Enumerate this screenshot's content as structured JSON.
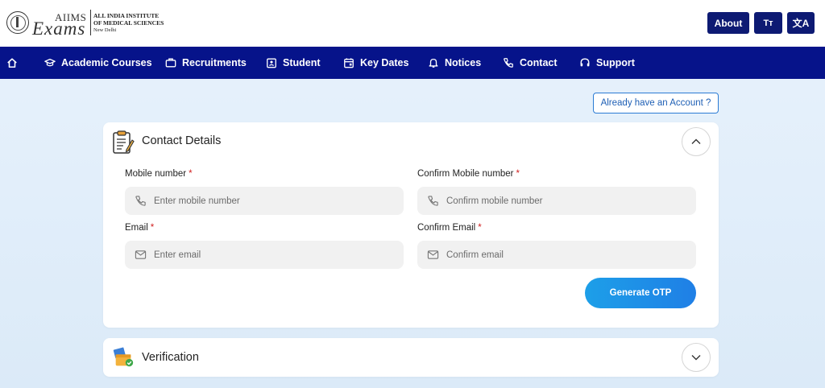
{
  "header": {
    "brand_top": "AIIMS",
    "brand_main": "Exams",
    "institute_line1": "ALL INDIA INSTITUTE",
    "institute_line2": "OF MEDICAL SCIENCES",
    "institute_city": "New Delhi",
    "about_label": "About",
    "text_size_label": "Tт",
    "language_label": "文A"
  },
  "nav": {
    "items": [
      {
        "label": "Academic Courses",
        "icon": "graduation-cap-icon"
      },
      {
        "label": "Recruitments",
        "icon": "briefcase-icon"
      },
      {
        "label": "Student",
        "icon": "id-card-icon"
      },
      {
        "label": "Key Dates",
        "icon": "calendar-icon"
      },
      {
        "label": "Notices",
        "icon": "bell-icon"
      },
      {
        "label": "Contact",
        "icon": "phone-icon"
      },
      {
        "label": "Support",
        "icon": "headset-icon"
      }
    ]
  },
  "account_link": "Already have an Account ?",
  "contact": {
    "title": "Contact Details",
    "mobile_label": "Mobile number",
    "mobile_placeholder": "Enter mobile number",
    "confirm_mobile_label": "Confirm Mobile number",
    "confirm_mobile_placeholder": "Confirm mobile number",
    "email_label": "Email",
    "email_placeholder": "Enter email",
    "confirm_email_label": "Confirm Email",
    "confirm_email_placeholder": "Confirm email",
    "required_mark": "*",
    "generate_otp_label": "Generate OTP"
  },
  "verification": {
    "title": "Verification"
  },
  "colors": {
    "nav_bg": "#06138a",
    "header_button_bg": "#0d1a73",
    "accent": "#1f7fe6",
    "required": "#d11f1f"
  }
}
